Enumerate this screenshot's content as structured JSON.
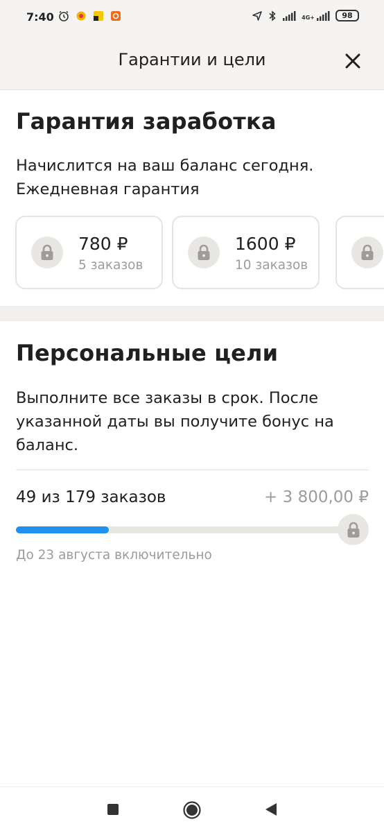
{
  "status_bar": {
    "time": "7:40",
    "network_label": "4G+",
    "battery": "98",
    "icons": [
      "alarm-icon",
      "timer-app-icon",
      "yandex-pro-icon",
      "orange-app-icon",
      "location-arrow-icon",
      "bluetooth-icon",
      "signal-icon",
      "signal-4g-icon",
      "battery-icon"
    ]
  },
  "header": {
    "title": "Гарантии и цели",
    "close_icon": "close-icon"
  },
  "guarantee": {
    "title": "Гарантия заработка",
    "description": "Начислится на ваш баланс сегодня. Ежедневная гарантия",
    "cards": [
      {
        "amount": "780 ₽",
        "orders": "5 заказов",
        "icon": "lock-icon"
      },
      {
        "amount": "1600 ₽",
        "orders": "10 заказов",
        "icon": "lock-icon"
      },
      {
        "amount": "",
        "orders": "",
        "icon": "lock-icon"
      }
    ]
  },
  "goals": {
    "title": "Персональные цели",
    "description": "Выполните все заказы в срок. После указанной даты вы получите бонус на баланс.",
    "progress_text": "49 из 179 заказов",
    "bonus": "+ 3 800,00 ₽",
    "progress_done": 49,
    "progress_total": 179,
    "deadline": "До 23 августа включительно"
  },
  "colors": {
    "accent": "#1f8ff0",
    "muted_text": "#9e9b98",
    "header_bg": "#f5f4f2"
  },
  "nav": {
    "buttons": [
      "recents-square-icon",
      "home-circle-icon",
      "back-triangle-icon"
    ]
  }
}
